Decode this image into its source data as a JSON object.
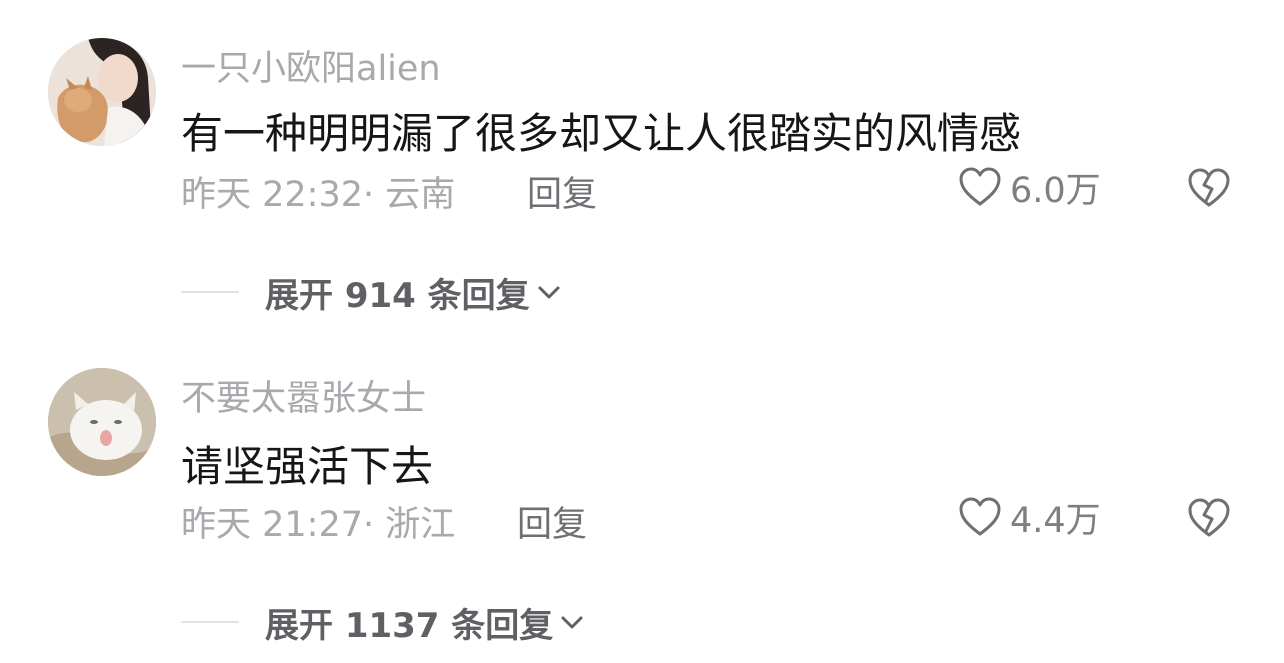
{
  "comments": [
    {
      "username": "一只小欧阳alien",
      "text": "有一种明明漏了很多却又让人很踏实的风情感",
      "meta": "昨天 22:32· 云南",
      "reply_label": "回复",
      "likes": "6.0万",
      "expand_label": "展开 914 条回复",
      "avatar_icon": "avatar-girl-with-cat"
    },
    {
      "username": "不要太嚣张女士",
      "text": "请坚强活下去",
      "meta": "昨天 21:27· 浙江",
      "reply_label": "回复",
      "likes": "4.4万",
      "expand_label": "展开 1137 条回复",
      "avatar_icon": "avatar-white-cat"
    }
  ],
  "icons": {
    "like": "heart-outline-icon",
    "dislike": "broken-heart-icon",
    "expand": "chevron-down-icon"
  },
  "colors": {
    "primary_text": "#161616",
    "secondary_text": "#a8a8ad",
    "action_text": "#6f6f74"
  }
}
